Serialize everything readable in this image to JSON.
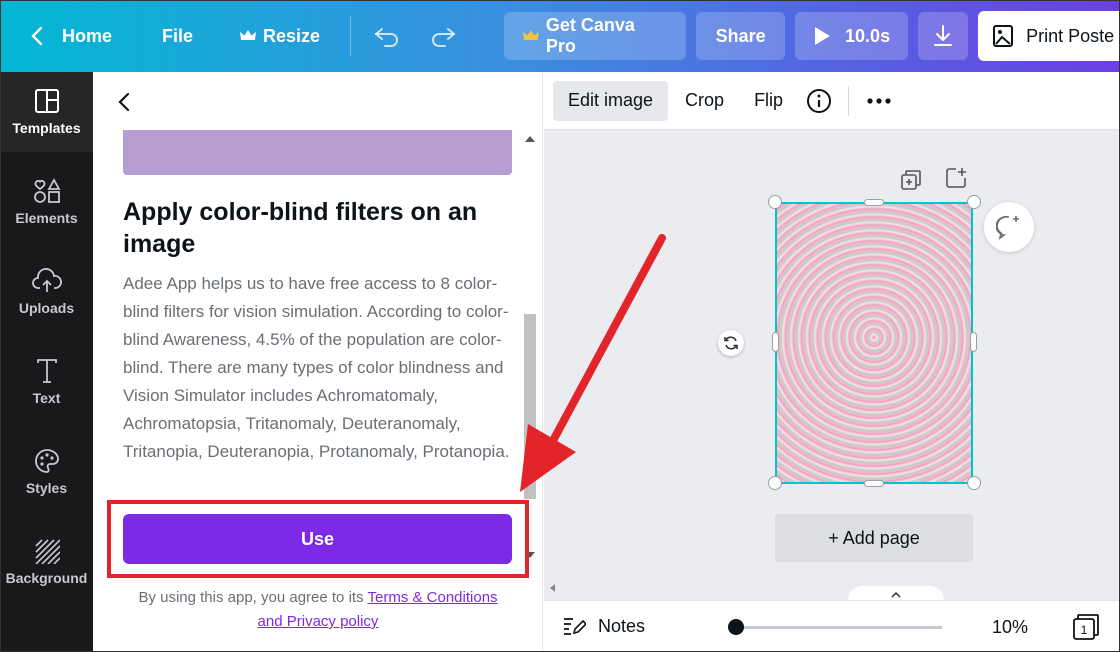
{
  "topbar": {
    "home": "Home",
    "file": "File",
    "resize": "Resize",
    "get_pro": "Get Canva Pro",
    "share": "Share",
    "play_duration": "10.0s",
    "print": "Print Poste"
  },
  "rail": {
    "items": [
      {
        "label": "Templates",
        "icon": "template-icon"
      },
      {
        "label": "Elements",
        "icon": "shapes-icon"
      },
      {
        "label": "Uploads",
        "icon": "cloud-upload-icon"
      },
      {
        "label": "Text",
        "icon": "text-t-icon"
      },
      {
        "label": "Styles",
        "icon": "palette-icon"
      },
      {
        "label": "Background",
        "icon": "hatch-icon"
      }
    ]
  },
  "panel": {
    "heading": "Apply color-blind filters on an image",
    "description": "Adee App helps us to have free access to 8 color-blind filters for vision simulation. According to color-blind Awareness, 4.5% of the population are color-blind. There are many types of color blindness and Vision Simulator includes Achromatomaly, Achromatopsia, Tritanomaly, Deuteranomaly, Tritanopia, Deuteranopia, Protanomaly, Protanopia.",
    "use_label": "Use",
    "terms_prefix": "By using this app, you agree to its",
    "terms_link1": "Terms & Conditions",
    "terms_link2": "and Privacy policy"
  },
  "toolbar": {
    "edit_image": "Edit image",
    "crop": "Crop",
    "flip": "Flip"
  },
  "canvas": {
    "add_page": "+ Add page"
  },
  "bottombar": {
    "notes": "Notes",
    "zoom": "10%",
    "page_count": "1",
    "zoom_slider_fraction": 0.02
  },
  "colors": {
    "accent": "#7d2ae8",
    "annotation": "#e3242b",
    "selection": "#00c4cc"
  }
}
